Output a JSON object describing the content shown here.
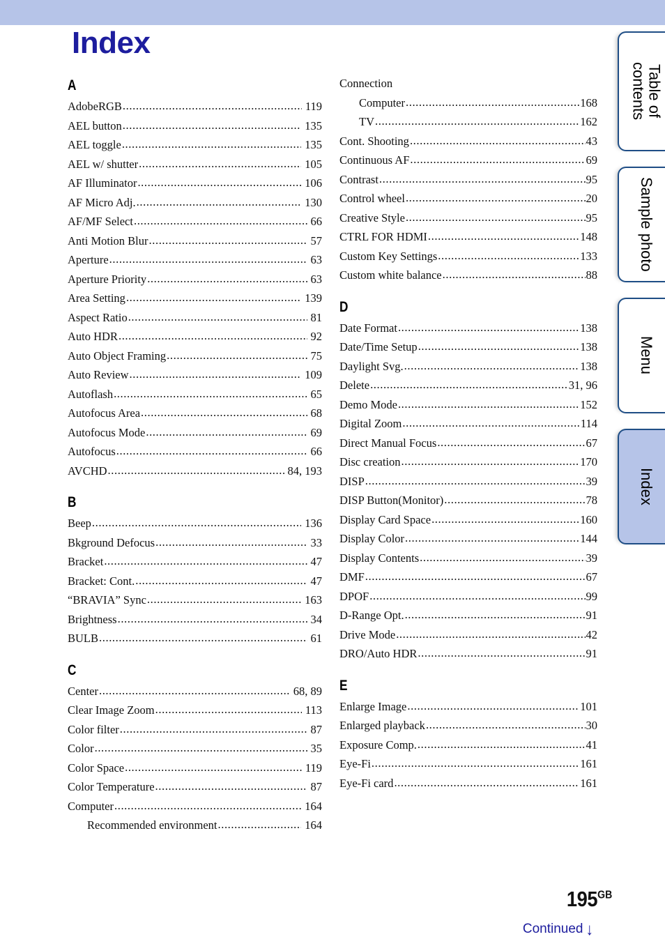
{
  "page": {
    "title": "Index",
    "number": "195",
    "number_suffix": "GB",
    "continued_label": "Continued",
    "continued_arrow": "↓",
    "accent_color": "#1d1d9e",
    "banner_color": "#b6c4e8",
    "tab_border_color": "#1f4e86"
  },
  "side_tabs": [
    {
      "label": "Table of\ncontents",
      "active": false
    },
    {
      "label": "Sample photo",
      "active": false
    },
    {
      "label": "Menu",
      "active": false
    },
    {
      "label": "Index",
      "active": true
    }
  ],
  "columns": [
    {
      "side": "left",
      "sections": [
        {
          "letter": "A",
          "entries": [
            {
              "label": "AdobeRGB",
              "page": "119",
              "sub": false
            },
            {
              "label": "AEL button",
              "page": "135",
              "sub": false
            },
            {
              "label": "AEL toggle",
              "page": "135",
              "sub": false
            },
            {
              "label": "AEL w/ shutter",
              "page": "105",
              "sub": false
            },
            {
              "label": "AF Illuminator",
              "page": "106",
              "sub": false
            },
            {
              "label": "AF Micro Adj.",
              "page": "130",
              "sub": false
            },
            {
              "label": "AF/MF Select",
              "page": "66",
              "sub": false
            },
            {
              "label": "Anti Motion Blur",
              "page": "57",
              "sub": false
            },
            {
              "label": "Aperture",
              "page": "63",
              "sub": false
            },
            {
              "label": "Aperture Priority",
              "page": "63",
              "sub": false
            },
            {
              "label": "Area Setting",
              "page": "139",
              "sub": false
            },
            {
              "label": "Aspect Ratio",
              "page": "81",
              "sub": false
            },
            {
              "label": "Auto HDR",
              "page": "92",
              "sub": false
            },
            {
              "label": "Auto Object Framing",
              "page": "75",
              "sub": false
            },
            {
              "label": "Auto Review",
              "page": "109",
              "sub": false
            },
            {
              "label": "Autoflash",
              "page": "65",
              "sub": false
            },
            {
              "label": "Autofocus Area",
              "page": "68",
              "sub": false
            },
            {
              "label": "Autofocus Mode",
              "page": "69",
              "sub": false
            },
            {
              "label": "Autofocus",
              "page": "66",
              "sub": false
            },
            {
              "label": "AVCHD",
              "page": "84, 193",
              "sub": false
            }
          ]
        },
        {
          "letter": "B",
          "entries": [
            {
              "label": "Beep",
              "page": "136",
              "sub": false
            },
            {
              "label": "Bkground Defocus",
              "page": "33",
              "sub": false
            },
            {
              "label": "Bracket",
              "page": "47",
              "sub": false
            },
            {
              "label": "Bracket: Cont.",
              "page": "47",
              "sub": false
            },
            {
              "label": "“BRAVIA” Sync",
              "page": "163",
              "sub": false
            },
            {
              "label": "Brightness",
              "page": "34",
              "sub": false
            },
            {
              "label": "BULB",
              "page": "61",
              "sub": false
            }
          ]
        },
        {
          "letter": "C",
          "entries": [
            {
              "label": "Center",
              "page": "68, 89",
              "sub": false
            },
            {
              "label": "Clear Image Zoom",
              "page": "113",
              "sub": false
            },
            {
              "label": "Color filter",
              "page": "87",
              "sub": false
            },
            {
              "label": "Color",
              "page": "35",
              "sub": false
            },
            {
              "label": "Color Space",
              "page": "119",
              "sub": false
            },
            {
              "label": "Color Temperature",
              "page": "87",
              "sub": false
            },
            {
              "label": "Computer",
              "page": "164",
              "sub": false
            },
            {
              "label": "Recommended environment",
              "page": "164",
              "sub": true
            }
          ]
        }
      ]
    },
    {
      "side": "right",
      "sections": [
        {
          "letter": "",
          "entries": [
            {
              "label": "Connection",
              "page": "",
              "sub": false,
              "noleader": true
            },
            {
              "label": "Computer",
              "page": "168",
              "sub": true
            },
            {
              "label": "TV",
              "page": "162",
              "sub": true
            },
            {
              "label": "Cont. Shooting",
              "page": "43",
              "sub": false
            },
            {
              "label": "Continuous AF",
              "page": "69",
              "sub": false
            },
            {
              "label": "Contrast",
              "page": "95",
              "sub": false
            },
            {
              "label": "Control wheel",
              "page": "20",
              "sub": false
            },
            {
              "label": "Creative Style",
              "page": "95",
              "sub": false
            },
            {
              "label": "CTRL FOR HDMI",
              "page": "148",
              "sub": false
            },
            {
              "label": "Custom Key Settings",
              "page": "133",
              "sub": false
            },
            {
              "label": "Custom white balance",
              "page": "88",
              "sub": false
            }
          ]
        },
        {
          "letter": "D",
          "entries": [
            {
              "label": "Date Format",
              "page": "138",
              "sub": false
            },
            {
              "label": "Date/Time Setup",
              "page": "138",
              "sub": false
            },
            {
              "label": "Daylight Svg.",
              "page": "138",
              "sub": false
            },
            {
              "label": "Delete",
              "page": "31, 96",
              "sub": false
            },
            {
              "label": "Demo Mode",
              "page": "152",
              "sub": false
            },
            {
              "label": "Digital Zoom",
              "page": "114",
              "sub": false
            },
            {
              "label": "Direct Manual Focus",
              "page": "67",
              "sub": false
            },
            {
              "label": "Disc creation",
              "page": "170",
              "sub": false
            },
            {
              "label": "DISP",
              "page": "39",
              "sub": false
            },
            {
              "label": "DISP Button(Monitor)",
              "page": "78",
              "sub": false
            },
            {
              "label": "Display Card Space",
              "page": "160",
              "sub": false
            },
            {
              "label": "Display Color",
              "page": "144",
              "sub": false
            },
            {
              "label": "Display Contents",
              "page": "39",
              "sub": false
            },
            {
              "label": "DMF",
              "page": "67",
              "sub": false
            },
            {
              "label": "DPOF",
              "page": "99",
              "sub": false
            },
            {
              "label": "D-Range Opt.",
              "page": "91",
              "sub": false
            },
            {
              "label": "Drive Mode",
              "page": "42",
              "sub": false
            },
            {
              "label": "DRO/Auto HDR",
              "page": "91",
              "sub": false
            }
          ]
        },
        {
          "letter": "E",
          "entries": [
            {
              "label": "Enlarge Image",
              "page": "101",
              "sub": false
            },
            {
              "label": "Enlarged playback",
              "page": "30",
              "sub": false
            },
            {
              "label": "Exposure Comp.",
              "page": "41",
              "sub": false
            },
            {
              "label": "Eye-Fi",
              "page": "161",
              "sub": false
            },
            {
              "label": "Eye-Fi card",
              "page": "161",
              "sub": false
            }
          ]
        }
      ]
    }
  ]
}
